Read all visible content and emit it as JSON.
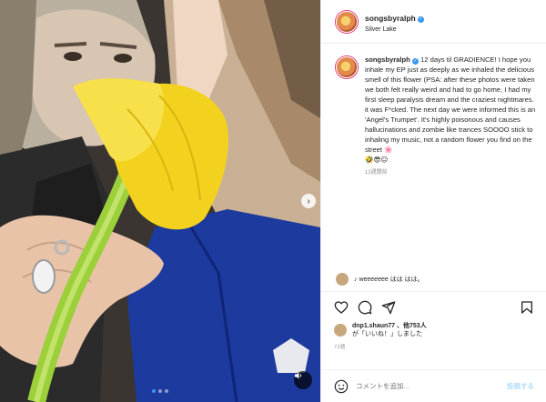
{
  "header": {
    "username": "songsbyralph",
    "location": "Silver Lake"
  },
  "caption": {
    "username": "songsbyralph",
    "text": "12 days til GRADIENCE! I hope you inhale my EP just as deeply as we inhaled the delicious smell of this flower (PSA: after these photos were taken we both felt really weird and had to go home, I had my first sleep paralysis dream and the craziest nightmares. it was F*cked. The next day we were informed this is an 'Angel's Trumpet'. It's highly poisonous and causes hallucinations and zombie like trances SOOOO stick to inhaling my music, not a random flower you find on the street 🌸",
    "emojis": "🤣😎😑",
    "time": "12週間前"
  },
  "comment_preview": {
    "text": "♪ weeeeeee はは はは。"
  },
  "likes": {
    "text": "dnp1.shaun77 、他753人",
    "suffix": "が「いいね！」しました"
  },
  "post_time": "72週",
  "compose": {
    "placeholder": "コメントを追加...",
    "post_label": "投稿する"
  },
  "colors": {
    "accent": "#3797f0",
    "verified": "#3897f0",
    "flower": "#f2d21e"
  },
  "icons": [
    "verified-badge-icon",
    "heart-icon",
    "comment-icon",
    "share-icon",
    "bookmark-icon",
    "emoji-icon",
    "chevron-right-icon",
    "sound-icon"
  ]
}
